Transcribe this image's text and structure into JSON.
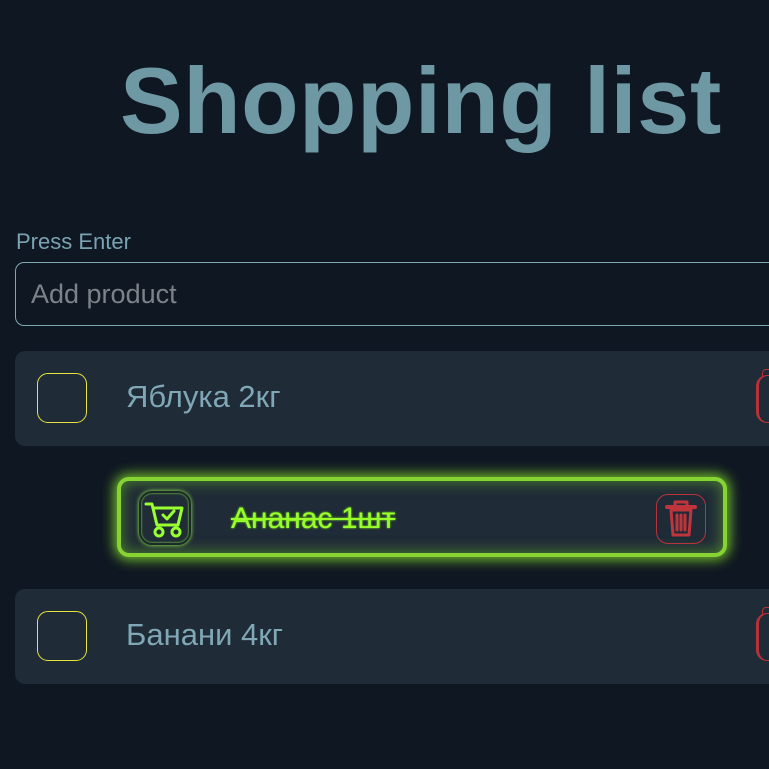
{
  "page": {
    "title": "Shopping list"
  },
  "form": {
    "hint": "Press Enter",
    "placeholder": "Add product"
  },
  "items": [
    {
      "label": "Яблука 2кг",
      "checked": false
    },
    {
      "label": "Ананас 1шт",
      "checked": true
    },
    {
      "label": "Банани 4кг",
      "checked": false
    }
  ],
  "icons": {
    "checked": "cart-check-icon",
    "delete": "trash-icon"
  },
  "colors": {
    "background": "#0f1722",
    "title": "#6e98a4",
    "item_background": "#1f2b37",
    "checkbox_border": "#e7e33f",
    "done_accent": "#86d433",
    "delete_accent": "#b8333a"
  }
}
